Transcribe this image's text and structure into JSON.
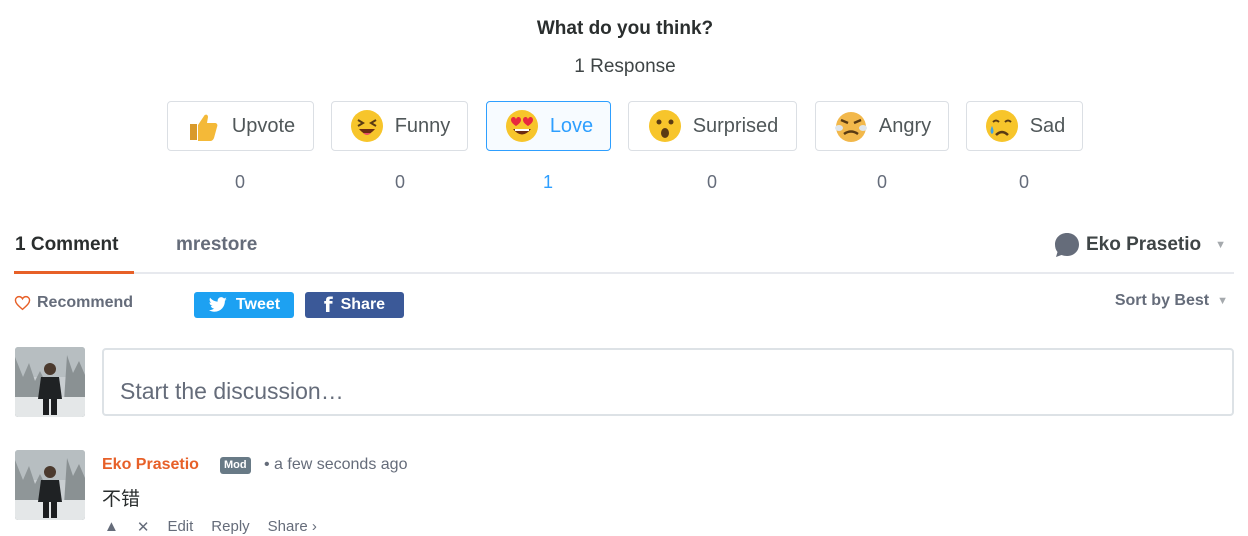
{
  "reactions_header": {
    "title": "What do you think?",
    "responses": "1 Response"
  },
  "reactions": [
    {
      "label": "Upvote",
      "icon": "thumbs-up-icon",
      "count": "0",
      "active": false
    },
    {
      "label": "Funny",
      "icon": "laughing-face-icon",
      "count": "0",
      "active": false
    },
    {
      "label": "Love",
      "icon": "heart-eyes-face-icon",
      "count": "1",
      "active": true
    },
    {
      "label": "Surprised",
      "icon": "surprised-face-icon",
      "count": "0",
      "active": false
    },
    {
      "label": "Angry",
      "icon": "angry-face-icon",
      "count": "0",
      "active": false
    },
    {
      "label": "Sad",
      "icon": "sad-face-icon",
      "count": "0",
      "active": false
    }
  ],
  "tabs": {
    "comments": "1 Comment",
    "forum": "mrestore"
  },
  "user_menu": {
    "name": "Eko Prasetio"
  },
  "toolbar": {
    "recommend": "Recommend",
    "tweet": "Tweet",
    "share": "Share",
    "sort": "Sort by Best"
  },
  "composer": {
    "placeholder": "Start the discussion…"
  },
  "comment": {
    "author": "Eko Prasetio",
    "badge": "Mod",
    "time": "• a few seconds ago",
    "text": "不错",
    "actions": {
      "edit": "Edit",
      "reply": "Reply",
      "share": "Share ›"
    }
  },
  "colors": {
    "accent": "#2e9fff",
    "brand_orange": "#e76028",
    "twitter": "#1da1f2",
    "facebook": "#3b5998"
  }
}
